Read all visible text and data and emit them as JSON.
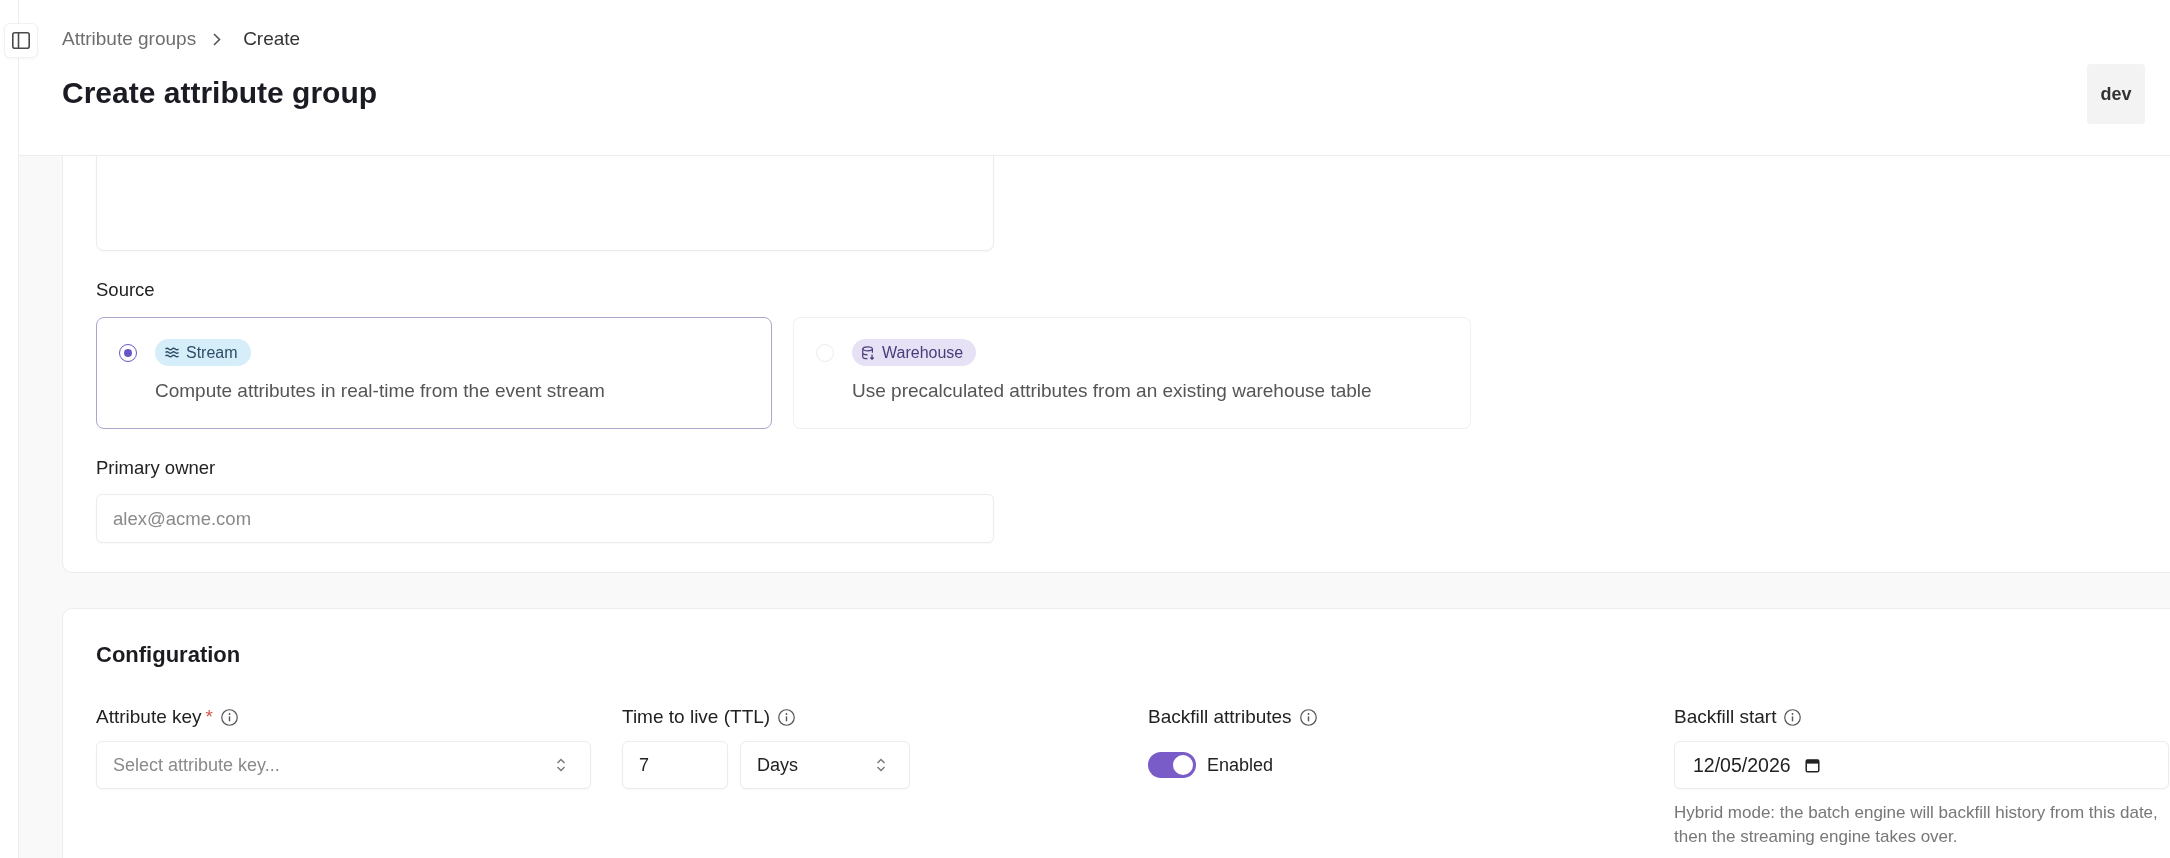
{
  "breadcrumb": [
    {
      "label": "Attribute groups",
      "current": false
    },
    {
      "label": "Create",
      "current": true
    }
  ],
  "page_title": "Create attribute group",
  "environment": "dev",
  "general": {
    "source": {
      "label": "Source",
      "options": [
        {
          "kind": "stream",
          "tag": "Stream",
          "description": "Compute attributes in real-time from the event stream",
          "selected": true
        },
        {
          "kind": "warehouse",
          "tag": "Warehouse",
          "description": "Use precalculated attributes from an existing warehouse table",
          "selected": false
        }
      ]
    },
    "primary_owner": {
      "label": "Primary owner",
      "placeholder": "alex@acme.com"
    }
  },
  "configuration": {
    "title": "Configuration",
    "fields": [
      {
        "kind": "select",
        "label": "Attribute key",
        "required_mark": "*",
        "placeholder": "Select attribute key..."
      },
      {
        "kind": "duration",
        "label": "Time to live (TTL)",
        "value": "7",
        "unit": "Days"
      },
      {
        "kind": "toggle",
        "label": "Backfill attributes",
        "on": true,
        "state_label": "Enabled"
      },
      {
        "kind": "date",
        "label": "Backfill start",
        "value": "12/05/2026",
        "hint": "Hybrid mode: the batch engine will backfill history from this date, then the streaming engine takes over."
      }
    ]
  }
}
